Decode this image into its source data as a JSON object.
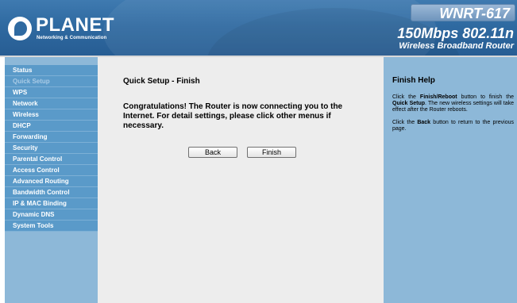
{
  "header": {
    "logo_word": "PLANET",
    "logo_sub": "Networking & Communication",
    "model": "WNRT-617",
    "speed": "150Mbps 802.11n",
    "product": "Wireless Broadband Router"
  },
  "sidebar": {
    "items": [
      {
        "label": "Status",
        "active": false
      },
      {
        "label": "Quick Setup",
        "active": true
      },
      {
        "label": "WPS",
        "active": false
      },
      {
        "label": "Network",
        "active": false
      },
      {
        "label": "Wireless",
        "active": false
      },
      {
        "label": "DHCP",
        "active": false
      },
      {
        "label": "Forwarding",
        "active": false
      },
      {
        "label": "Security",
        "active": false
      },
      {
        "label": "Parental Control",
        "active": false
      },
      {
        "label": "Access Control",
        "active": false
      },
      {
        "label": "Advanced Routing",
        "active": false
      },
      {
        "label": "Bandwidth Control",
        "active": false
      },
      {
        "label": "IP & MAC Binding",
        "active": false
      },
      {
        "label": "Dynamic DNS",
        "active": false
      },
      {
        "label": "System Tools",
        "active": false
      }
    ]
  },
  "main": {
    "title": "Quick Setup - Finish",
    "message": "Congratulations! The Router is now connecting you to the Internet. For detail settings, please click other menus if necessary.",
    "back_label": "Back",
    "finish_label": "Finish"
  },
  "help": {
    "title": "Finish Help",
    "p1_a": "Click the ",
    "p1_b": "Finish/Reboot",
    "p1_c": " button to finish the ",
    "p1_d": "Quick Setup",
    "p1_e": ". The new wireless settings will take effect after the Router reboots.",
    "p2_a": "Click the ",
    "p2_b": "Back",
    "p2_c": " button to return to the previous page."
  },
  "colors": {
    "header": "#2f6aa1",
    "sidebar": "#8db8d8",
    "menu_item": "#5a9ac9",
    "main_bg": "#ededed"
  }
}
